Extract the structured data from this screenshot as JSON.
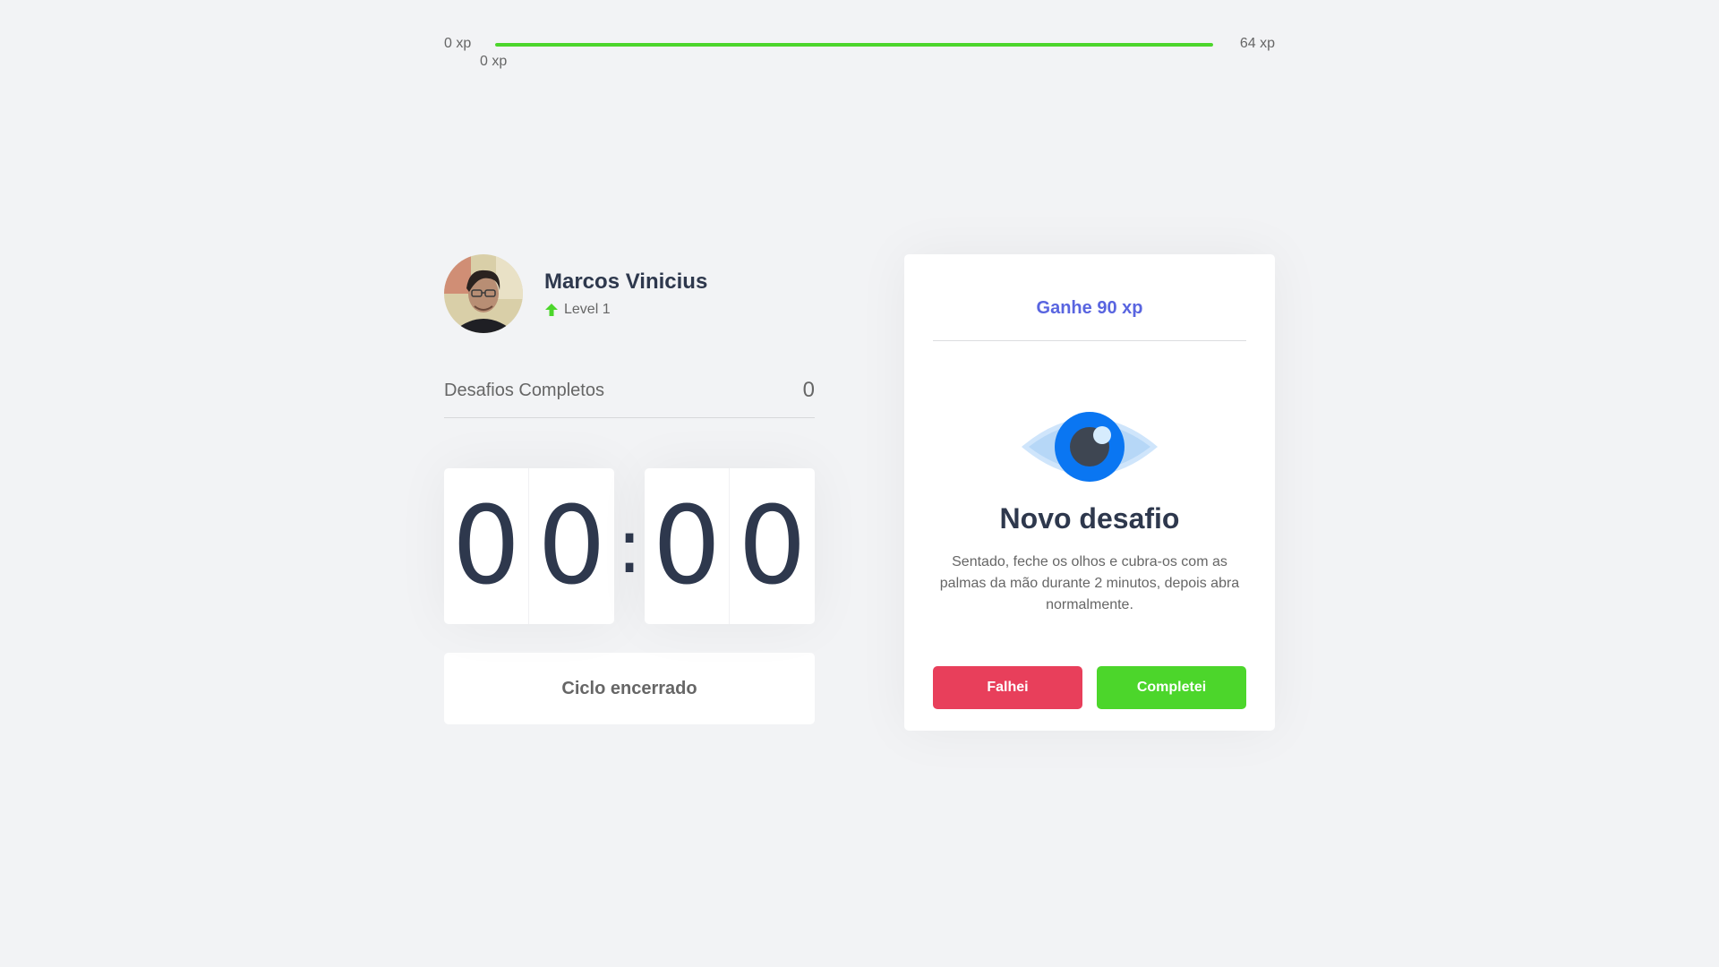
{
  "xp": {
    "min_label": "0 xp",
    "max_label": "64 xp",
    "current_label": "0 xp",
    "progress": 1.0,
    "bar_color": "#4cd62b"
  },
  "profile": {
    "name": "Marcos Vinicius",
    "level": "Level 1",
    "level_icon": "level-up-arrow-icon"
  },
  "stats": {
    "completed_label": "Desafios Completos",
    "completed_count": "0"
  },
  "countdown": {
    "minutes_left": "0",
    "minutes_right": "0",
    "separator": ":",
    "seconds_left": "0",
    "seconds_right": "0"
  },
  "cycle_button": {
    "label": "Ciclo encerrado"
  },
  "challenge": {
    "header": "Ganhe 90 xp",
    "icon": "eye-icon",
    "title": "Novo desafio",
    "description": "Sentado, feche os olhos e cubra-os com as palmas da mão durante 2 minutos, depois abra normalmente.",
    "fail_label": "Falhei",
    "success_label": "Completei"
  },
  "colors": {
    "accent": "#5965e0",
    "success": "#4cd62b",
    "danger": "#e83f5b",
    "title": "#2e384d"
  }
}
